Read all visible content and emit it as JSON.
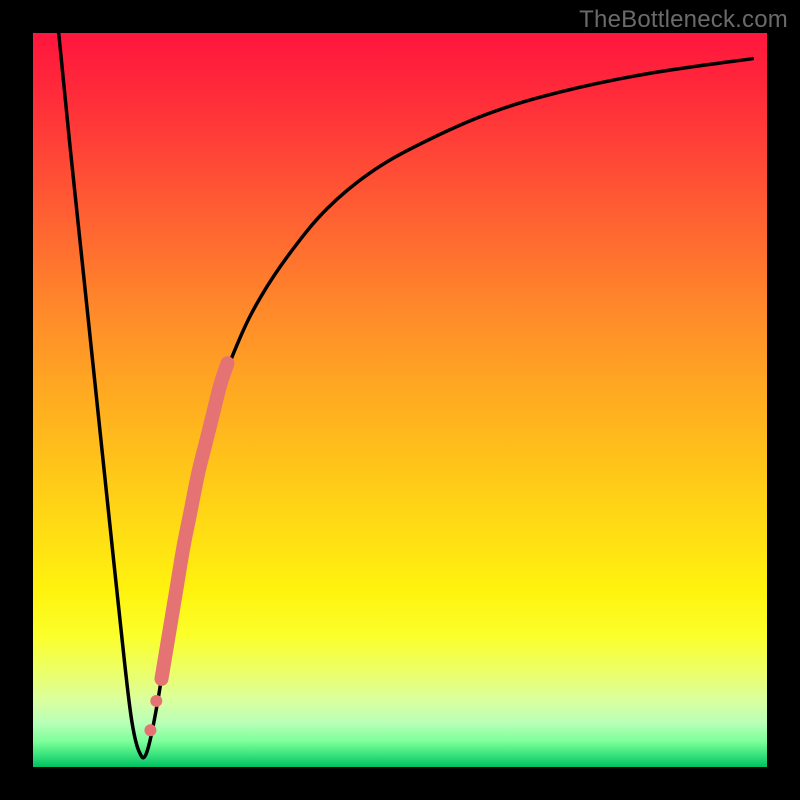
{
  "watermark": "TheBottleneck.com",
  "colors": {
    "curve": "#000000",
    "highlight": "#e57373",
    "frame": "#000000"
  },
  "chart_data": {
    "type": "line",
    "title": "",
    "xlabel": "",
    "ylabel": "",
    "xlim": [
      0,
      100
    ],
    "ylim": [
      0,
      100
    ],
    "grid": false,
    "series": [
      {
        "name": "bottleneck-curve",
        "x": [
          3.5,
          5,
          7,
          9,
          11,
          12.5,
          13.5,
          14.5,
          15.5,
          17,
          19,
          21,
          23,
          25,
          28,
          31,
          35,
          40,
          46,
          53,
          62,
          72,
          84,
          98
        ],
        "y": [
          100,
          85,
          66,
          47,
          28,
          14,
          6,
          2,
          2,
          9,
          22,
          33,
          42,
          50,
          58,
          64,
          70,
          76,
          81,
          85,
          89,
          92,
          94.5,
          96.5
        ]
      }
    ],
    "highlight_segment": {
      "comment": "thick salmon segment on the ascending branch + two dots near the dip",
      "x": [
        17.5,
        18.5,
        19.5,
        20.5,
        21.5,
        22.5,
        23.5,
        24.5,
        25.5,
        26.5
      ],
      "y": [
        12,
        18,
        24,
        30,
        35,
        40,
        44,
        48,
        52,
        55
      ],
      "dots": [
        {
          "x": 16.0,
          "y": 5
        },
        {
          "x": 16.8,
          "y": 9
        }
      ]
    }
  }
}
